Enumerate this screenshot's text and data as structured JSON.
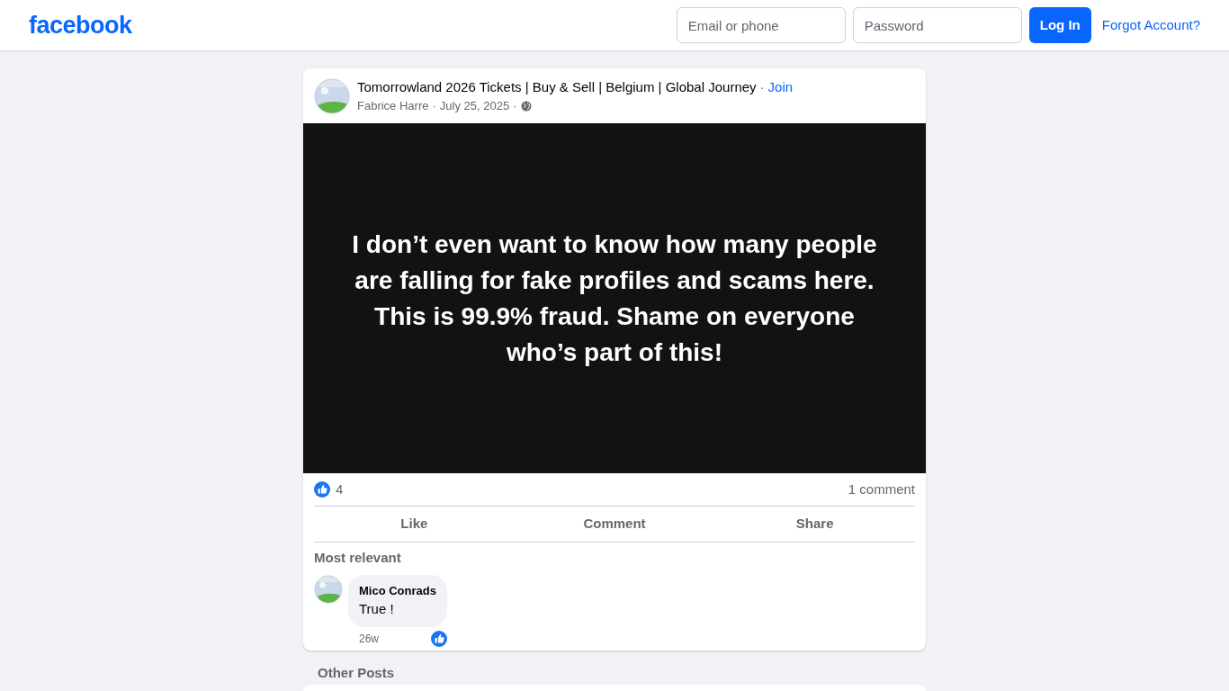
{
  "header": {
    "logo": "facebook",
    "email": {
      "placeholder": "Email or phone"
    },
    "password": {
      "placeholder": "Password"
    },
    "login_button": "Log In",
    "forgot_link": "Forgot Account?"
  },
  "post": {
    "group": "Tomorrowland 2026 Tickets | Buy & Sell | Belgium | Global Journey",
    "join": "Join",
    "separator": "·",
    "author": "Fabrice Harre",
    "date": "July 25, 2025",
    "text_lines": [
      "I don’t even want to know how many people",
      "are falling for fake profiles and scams here.",
      "This is 99.9% fraud. Shame on everyone",
      "who’s part of this!"
    ],
    "reactions": "4",
    "comments_count": "1 comment",
    "actions": [
      "Like",
      "Comment",
      "Share"
    ],
    "sort": "Most relevant",
    "comments": [
      {
        "name": "Mico Conrads",
        "text": "True !",
        "time": "26w"
      }
    ]
  },
  "other_posts_title": "Other Posts"
}
